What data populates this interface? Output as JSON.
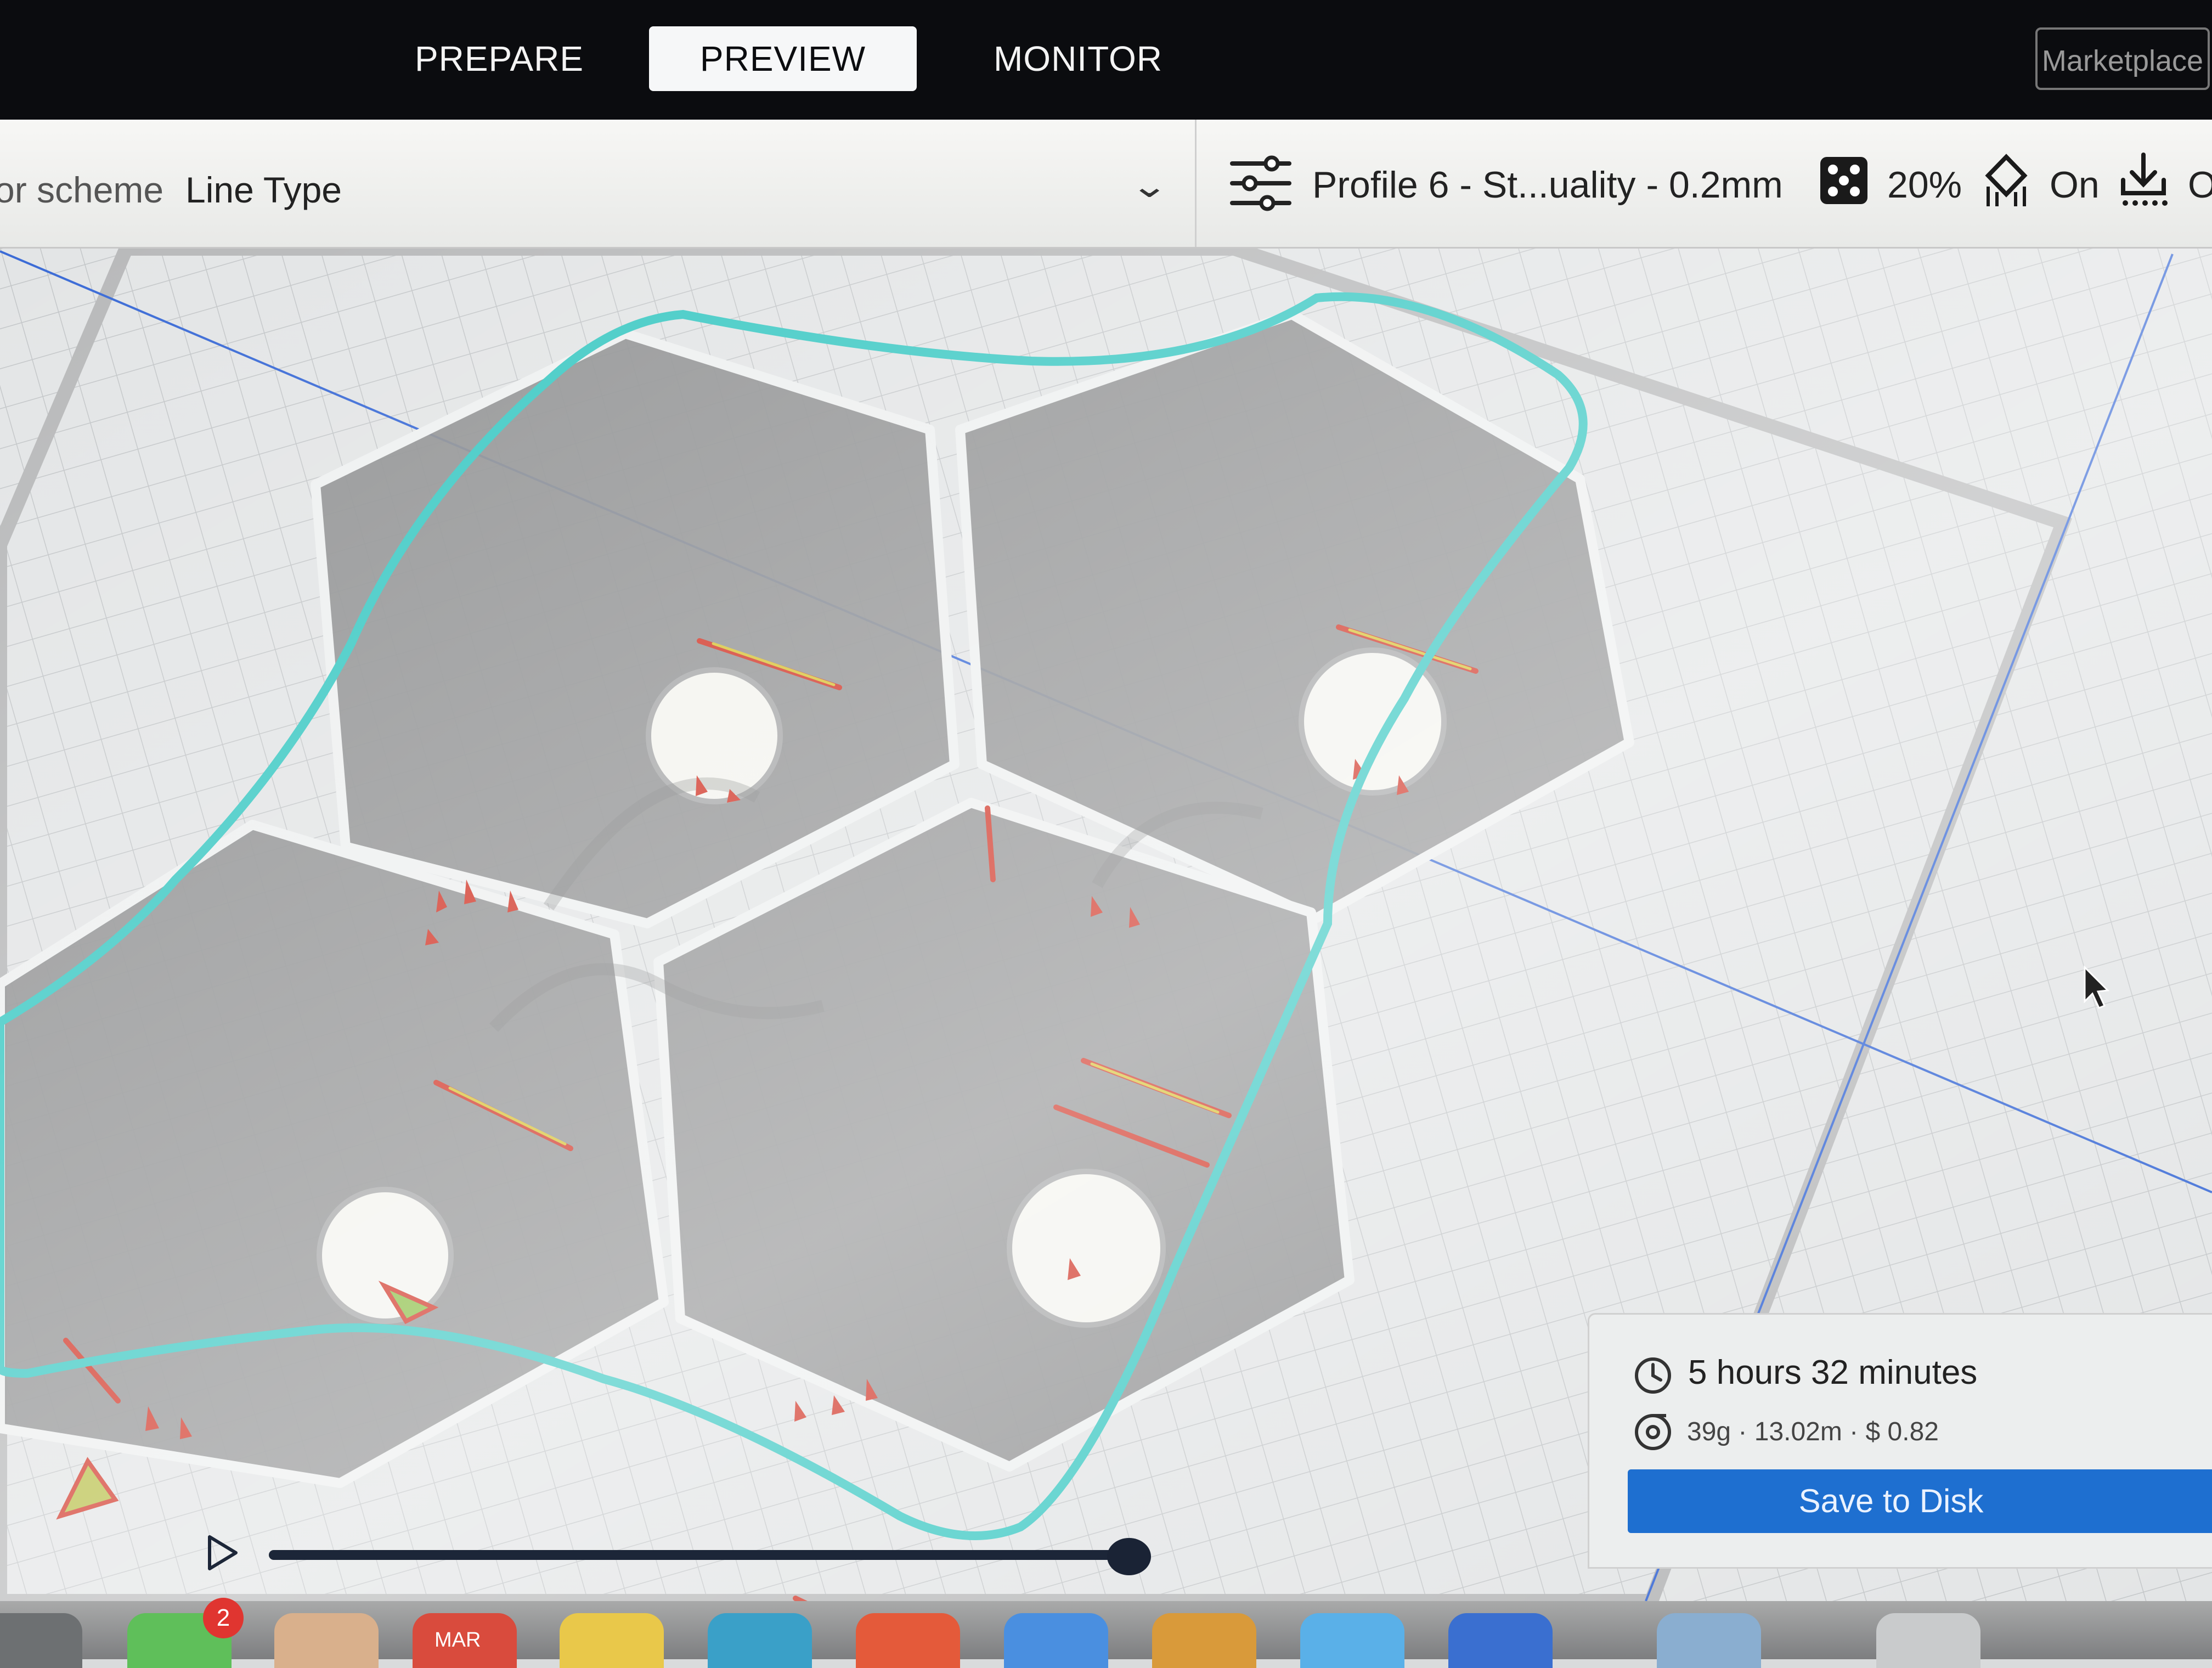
{
  "stage_tabs": {
    "prepare": "PREPARE",
    "preview": "PREVIEW",
    "monitor": "MONITOR",
    "active": "preview"
  },
  "marketplace_label": "Marketplace",
  "view_controls": {
    "color_scheme_label": "or scheme",
    "color_scheme_value": "Line Type",
    "chevron_icon": "chevron-down-icon"
  },
  "print_setup": {
    "settings_icon": "sliders-icon",
    "profile": "Profile 6 - St...uality - 0.2mm",
    "infill_icon": "infill-icon",
    "infill": "20%",
    "support_icon": "support-icon",
    "support": "On",
    "adhesion_icon": "adhesion-icon",
    "adhesion": "O"
  },
  "print_info": {
    "clock_icon": "clock-icon",
    "time": "5 hours 32 minutes",
    "spool_icon": "spool-icon",
    "material": "39g · 13.02m · $ 0.82",
    "save_button": "Save to Disk"
  },
  "layer_slider": {
    "play_icon": "play-icon",
    "progress": 0.98
  },
  "dock": {
    "badge_count": "2",
    "calendar_month": "MAR"
  },
  "colors": {
    "accent_blue": "#1e6fd0",
    "skirt_cyan": "#3ec9c4",
    "wall_red": "#d23a2c",
    "infill_yellow": "#d8c43a",
    "model_gray": "#8e8f90",
    "topbar": "#0b0c0f"
  }
}
